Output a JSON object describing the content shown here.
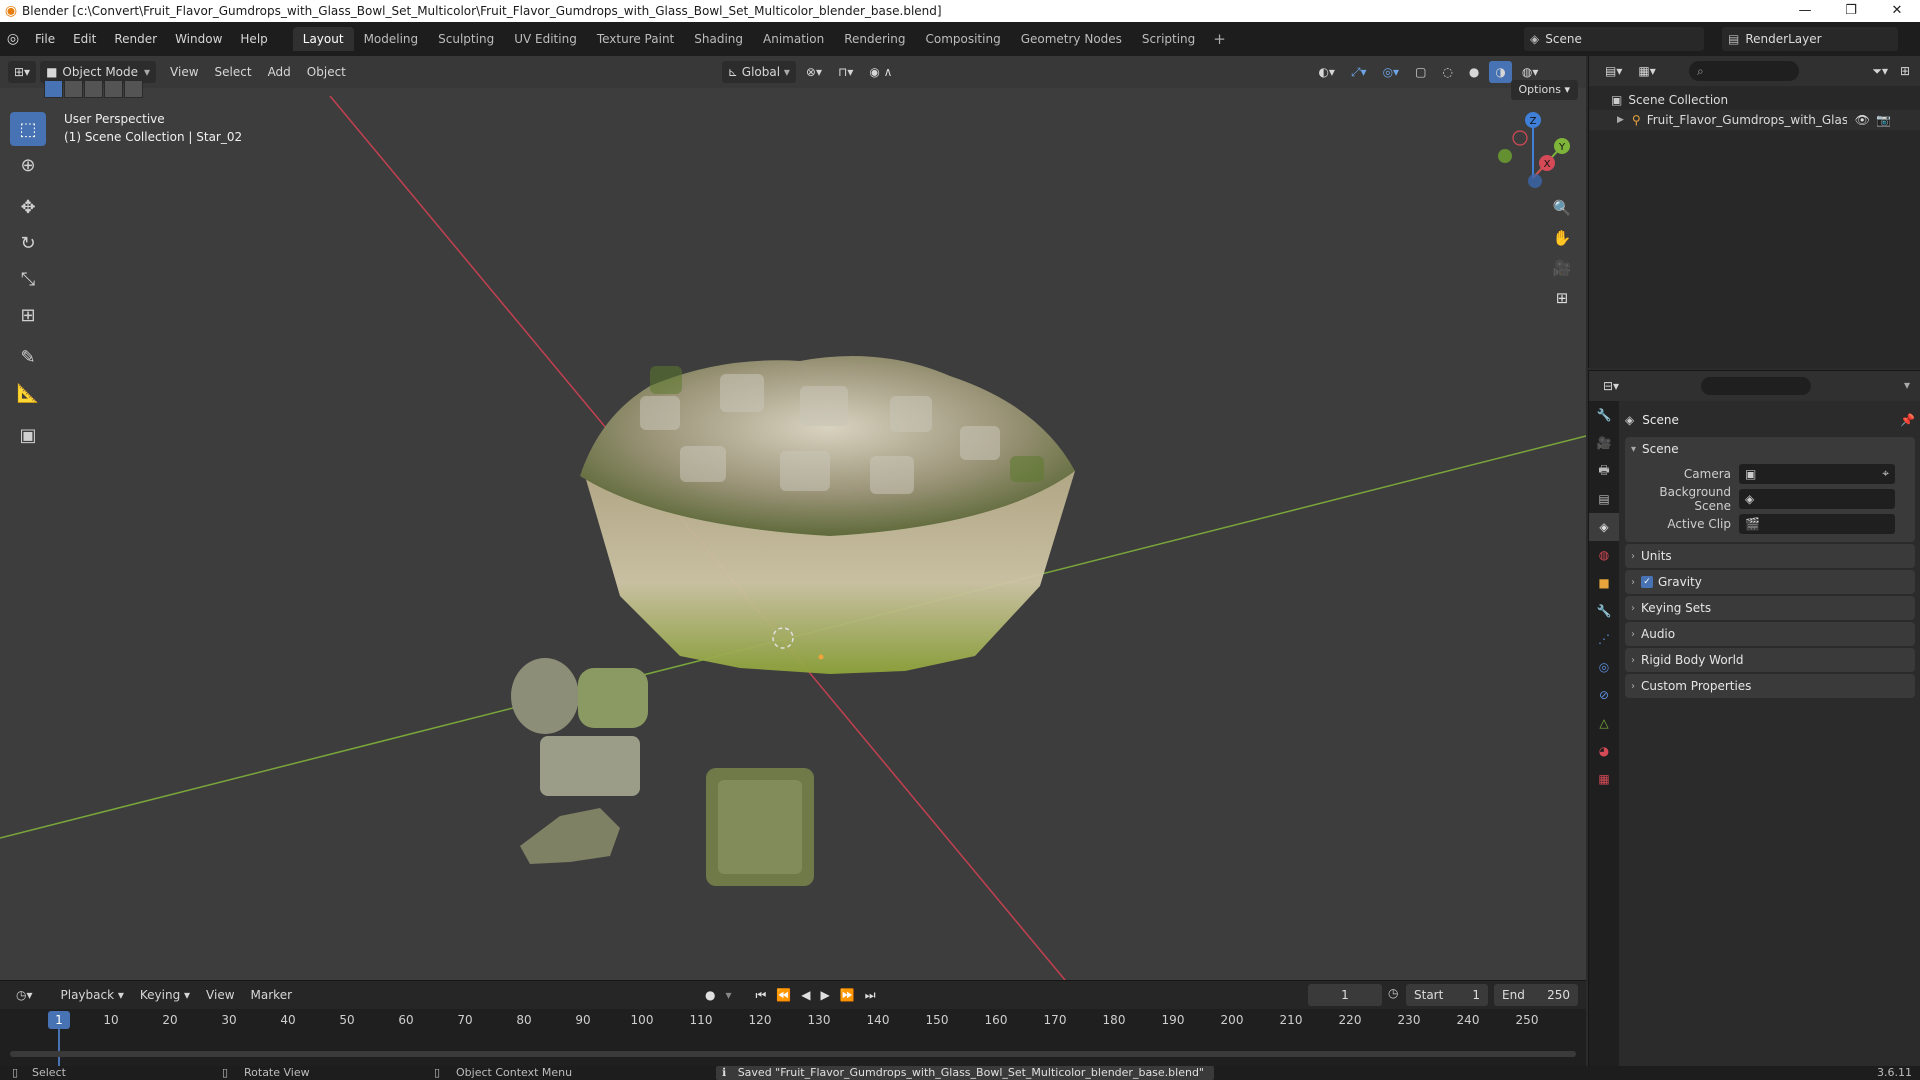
{
  "window": {
    "title": "Blender [c:\\Convert\\Fruit_Flavor_Gumdrops_with_Glass_Bowl_Set_Multicolor\\Fruit_Flavor_Gumdrops_with_Glass_Bowl_Set_Multicolor_blender_base.blend]",
    "minimize": "—",
    "maximize": "❐",
    "close": "✕"
  },
  "menu": [
    "File",
    "Edit",
    "Render",
    "Window",
    "Help"
  ],
  "workspaces": [
    "Layout",
    "Modeling",
    "Sculpting",
    "UV Editing",
    "Texture Paint",
    "Shading",
    "Animation",
    "Rendering",
    "Compositing",
    "Geometry Nodes",
    "Scripting"
  ],
  "workspace_add": "+",
  "scene_name": "Scene",
  "render_layer": "RenderLayer",
  "viewport": {
    "mode": "Object Mode",
    "menus": [
      "View",
      "Select",
      "Add",
      "Object"
    ],
    "transform_orientation": "Global",
    "perspective_label": "User Perspective",
    "collection_label": "(1) Scene Collection | Star_02",
    "options_label": "Options",
    "gizmo_axes": {
      "x": "X",
      "y": "Y",
      "z": "Z"
    }
  },
  "outliner": {
    "root": "Scene Collection",
    "item": "Fruit_Flavor_Gumdrops_with_Glass_Bov"
  },
  "properties": {
    "context_title": "Scene",
    "panel_title": "Scene",
    "rows": [
      {
        "label": "Camera"
      },
      {
        "label": "Background Scene"
      },
      {
        "label": "Active Clip"
      }
    ],
    "collapsed_panels": [
      "Units",
      "Gravity",
      "Keying Sets",
      "Audio",
      "Rigid Body World",
      "Custom Properties"
    ],
    "gravity_checked": true
  },
  "timeline": {
    "menus": [
      "Playback",
      "Keying",
      "View",
      "Marker"
    ],
    "current_frame": "1",
    "start_label": "Start",
    "start_value": "1",
    "end_label": "End",
    "end_value": "250",
    "ruler": [
      "10",
      "20",
      "30",
      "40",
      "50",
      "60",
      "70",
      "80",
      "90",
      "100",
      "110",
      "120",
      "130",
      "140",
      "150",
      "160",
      "170",
      "180",
      "190",
      "200",
      "210",
      "220",
      "230",
      "240",
      "250"
    ]
  },
  "status": {
    "select": "Select",
    "rotate": "Rotate View",
    "context_menu": "Object Context Menu",
    "saved": "Saved \"Fruit_Flavor_Gumdrops_with_Glass_Bowl_Set_Multicolor_blender_base.blend\"",
    "version": "3.6.11"
  },
  "colors": {
    "accent": "#4772b3",
    "x_axis": "#d44a57",
    "y_axis": "#7fb43a",
    "z_axis": "#3f7fd8"
  }
}
